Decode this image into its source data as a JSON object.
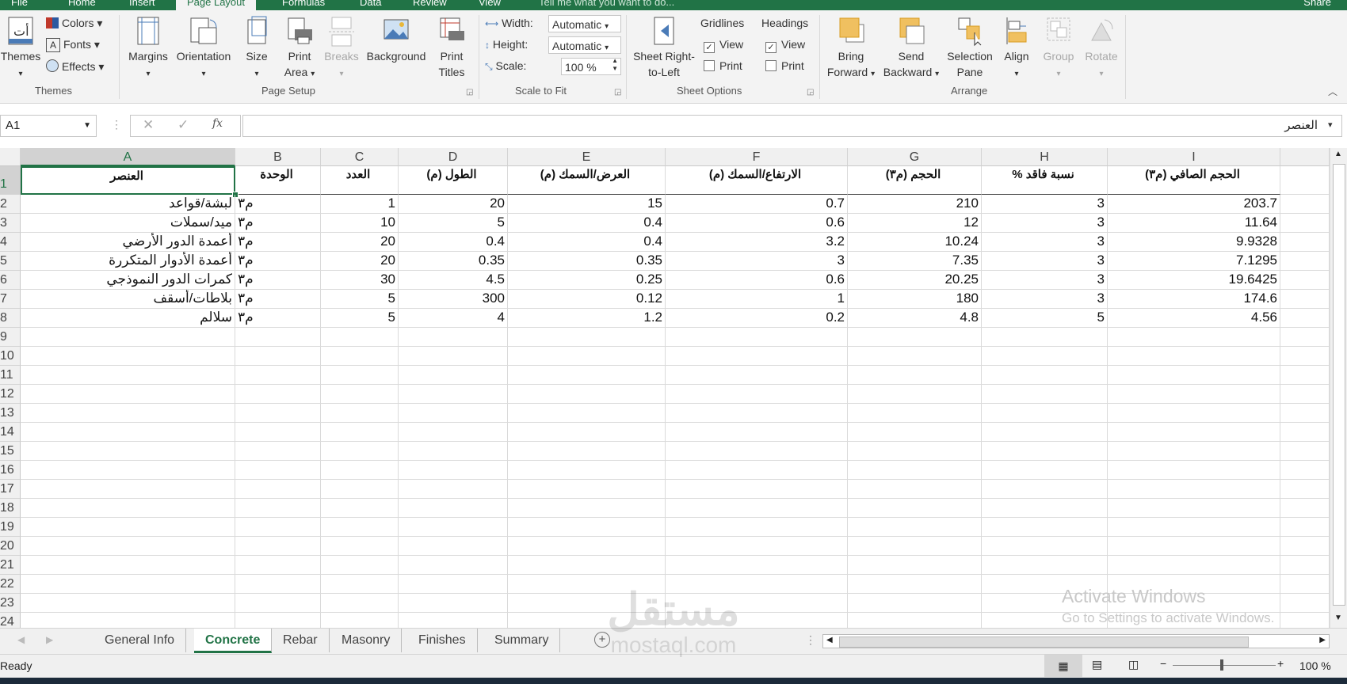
{
  "ribbon_tabs": [
    "File",
    "Home",
    "Insert",
    "Page Layout",
    "Formulas",
    "Data",
    "Review",
    "View"
  ],
  "tell_me": "Tell me what you want to do...",
  "share": "Share",
  "themes_group": {
    "themes": "Themes",
    "colors": "Colors",
    "fonts": "Fonts",
    "effects": "Effects",
    "label": "Themes"
  },
  "page_setup": {
    "margins": "Margins",
    "orientation": "Orientation",
    "size": "Size",
    "print_area_1": "Print",
    "print_area_2": "Area",
    "breaks": "Breaks",
    "background": "Background",
    "print_titles_1": "Print",
    "print_titles_2": "Titles",
    "label": "Page Setup"
  },
  "scale_to_fit": {
    "width_label": "Width:",
    "width_value": "Automatic",
    "height_label": "Height:",
    "height_value": "Automatic",
    "scale_label": "Scale:",
    "scale_value": "100 %",
    "label": "Scale to Fit"
  },
  "sheet_options": {
    "rtl_1": "Sheet Right-",
    "rtl_2": "to-Left",
    "gridlines": "Gridlines",
    "headings": "Headings",
    "view": "View",
    "print": "Print",
    "label": "Sheet Options"
  },
  "arrange": {
    "bring_1": "Bring",
    "bring_2": "Forward",
    "send_1": "Send",
    "send_2": "Backward",
    "selection_1": "Selection",
    "selection_2": "Pane",
    "align": "Align",
    "group": "Group",
    "rotate": "Rotate",
    "label": "Arrange"
  },
  "formula_bar": {
    "name_box": "A1",
    "fx": "fx",
    "content": "العنصر"
  },
  "columns": [
    "A",
    "B",
    "C",
    "D",
    "E",
    "F",
    "G",
    "H",
    "I"
  ],
  "header_row": [
    "العنصر",
    "الوحدة",
    "العدد",
    "الطول (م)",
    "العرض/السمك (م)",
    "الارتفاع/السمك (م)",
    "الحجم (م٣)",
    "نسبة فاقد %",
    "الحجم الصافي (م٣)"
  ],
  "rows": [
    [
      "لبشة/قواعد",
      "م٣",
      "1",
      "20",
      "15",
      "0.7",
      "210",
      "3",
      "203.7"
    ],
    [
      "ميد/سملات",
      "م٣",
      "10",
      "5",
      "0.4",
      "0.6",
      "12",
      "3",
      "11.64"
    ],
    [
      "أعمدة الدور الأرضي",
      "م٣",
      "20",
      "0.4",
      "0.4",
      "3.2",
      "10.24",
      "3",
      "9.9328"
    ],
    [
      "أعمدة الأدوار المتكررة",
      "م٣",
      "20",
      "0.35",
      "0.35",
      "3",
      "7.35",
      "3",
      "7.1295"
    ],
    [
      "كمرات الدور النموذجي",
      "م٣",
      "30",
      "4.5",
      "0.25",
      "0.6",
      "20.25",
      "3",
      "19.6425"
    ],
    [
      "بلاطات/أسقف",
      "م٣",
      "5",
      "300",
      "0.12",
      "1",
      "180",
      "3",
      "174.6"
    ],
    [
      "سلالم",
      "م٣",
      "5",
      "4",
      "1.2",
      "0.2",
      "4.8",
      "5",
      "4.56"
    ]
  ],
  "row_numbers": [
    "1",
    "2",
    "3",
    "4",
    "5",
    "6",
    "7",
    "8",
    "9",
    "10",
    "11",
    "12",
    "13",
    "14",
    "15",
    "16",
    "17",
    "18",
    "19",
    "20",
    "21",
    "22",
    "23",
    "24"
  ],
  "sheet_tabs": [
    "General Info",
    "Concrete",
    "Rebar",
    "Masonry",
    "Finishes",
    "Summary"
  ],
  "active_sheet": "Concrete",
  "status": {
    "ready": "Ready",
    "zoom": "100 %"
  },
  "watermark": {
    "line1": "Activate Windows",
    "line2": "Go to Settings to activate Windows."
  },
  "logo_text": {
    "arabic": "مستقل",
    "latin": "mostaql.com"
  },
  "colors": {
    "excel_green": "#217346",
    "ribbon_bg": "#f3f3f3"
  }
}
